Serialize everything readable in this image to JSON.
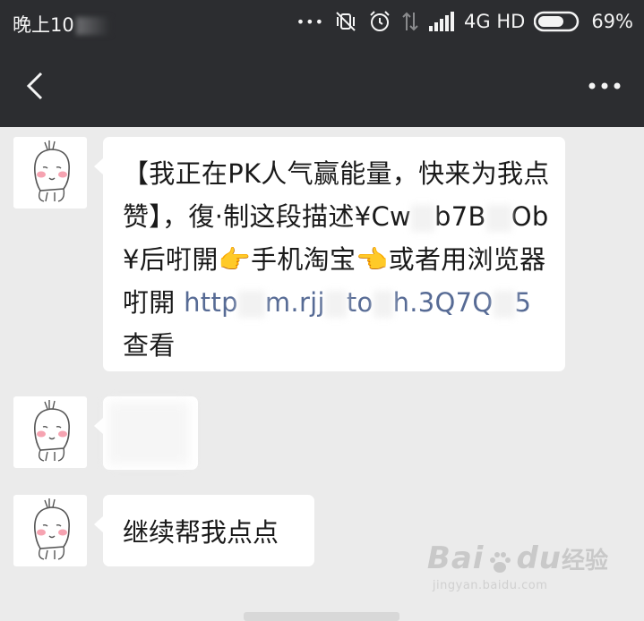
{
  "status_bar": {
    "time": "晚上10",
    "dots": "•••",
    "network": "4G HD",
    "battery_percent": "69%",
    "battery_level": 0.69,
    "icons": [
      "overflow-dots-icon",
      "vibrate-off-icon",
      "alarm-icon",
      "data-arrows-icon",
      "signal-icon",
      "battery-icon"
    ]
  },
  "title_bar": {
    "back_icon": "chevron-left-icon",
    "more_label": "•••"
  },
  "messages": [
    {
      "parts": [
        "【我正在PK人气赢能量，快来为我点赞】，復·制这段描述¥Cw",
        "b7B",
        "Ob¥后咑開👉手机淘宝👈或者用浏览器咑開 "
      ],
      "link_parts": [
        "http",
        "m.",
        "rjj",
        "to",
        "h.3Q7Q",
        "5"
      ],
      "tail": " 查看"
    },
    {
      "text": ""
    },
    {
      "text": "继续帮我点点"
    }
  ],
  "watermark": {
    "brand": "Bai",
    "brand2": "du",
    "cn": "经验",
    "url": "jingyan.baidu.com"
  },
  "colors": {
    "header_bg": "#2c2d30",
    "chat_bg": "#ebebeb",
    "bubble_bg": "#ffffff",
    "link": "#576b95"
  }
}
